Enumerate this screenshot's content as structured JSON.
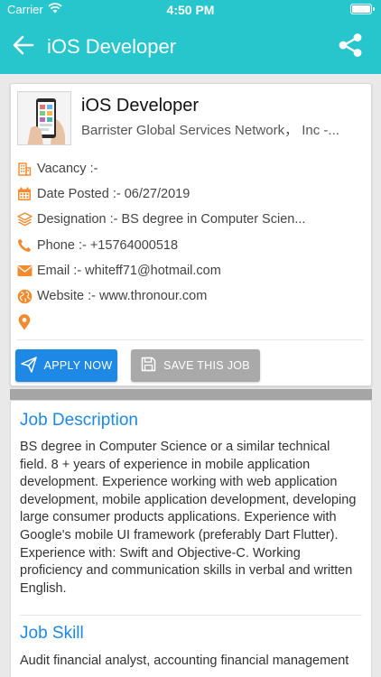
{
  "status_bar": {
    "carrier": "Carrier",
    "time": "4:50 PM"
  },
  "nav": {
    "title": "iOS Developer"
  },
  "job": {
    "title": "iOS Developer",
    "company": "Barrister Global Services Network， Inc -...",
    "vacancy": "Vacancy :-",
    "date_posted": "Date Posted :- 06/27/2019",
    "designation": "Designation :- BS degree in Computer Scien...",
    "phone": "Phone :- +15764000518",
    "email": "Email :- whiteff71@hotmail.com",
    "website": "Website :- www.thronour.com",
    "location": ""
  },
  "actions": {
    "apply_label": "APPLY NOW",
    "save_label": "SAVE THIS JOB"
  },
  "description": {
    "title": "Job Description",
    "text": "BS degree in Computer Science or a similar technical field. 8 + years of experience in mobile application development. Experience working with web application development, mobile application development, developing large consumer products applications. Experience with Google's mobile UI framework (preferably Dart Flutter). Experience with: Swift and Objective-C. Working proficiency and communication skills in verbal and written English."
  },
  "skills": {
    "title": "Job Skill",
    "text": "Audit financial analyst, accounting financial management"
  },
  "colors": {
    "header": "#26c6cc",
    "accent_icon": "#f28a2e",
    "link_blue": "#1e88e5",
    "save_grey": "#a9a9a9"
  },
  "icons": [
    "back-arrow-icon",
    "share-icon",
    "building-icon",
    "calendar-icon",
    "layers-icon",
    "phone-icon",
    "envelope-icon",
    "globe-icon",
    "map-pin-icon",
    "paper-plane-icon",
    "floppy-disk-icon",
    "wifi-icon",
    "battery-icon"
  ]
}
